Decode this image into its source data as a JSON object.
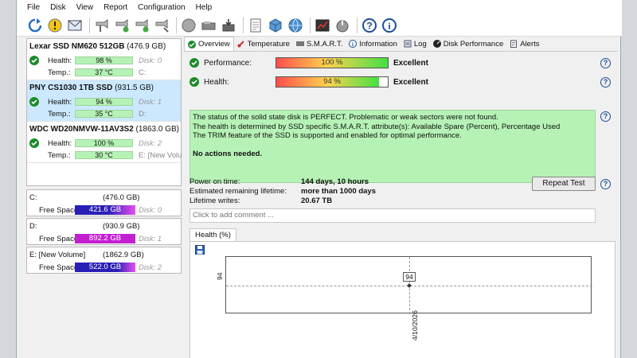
{
  "menu": [
    "File",
    "Disk",
    "View",
    "Report",
    "Configuration",
    "Help"
  ],
  "toolbar_icons": [
    "refresh-icon",
    "warning-icon",
    "envelope-icon",
    "smart-test-icon",
    "smart-test-icon",
    "smart-test-icon",
    "smart-test-icon",
    "disk-icon",
    "disk-icon",
    "disk-icon",
    "document-icon",
    "cube-icon",
    "network-icon",
    "benchmark-icon",
    "power-icon",
    "help-icon",
    "info-icon"
  ],
  "disks": [
    {
      "name": "Lexar SSD NM620 512GB",
      "capacity": "(476.9 GB)",
      "health_label": "Health:",
      "health": "98 %",
      "health_value": 98,
      "temp_label": "Temp.:",
      "temp": "37 °C",
      "disk": "Disk: 0",
      "drive": "C:",
      "selected": false
    },
    {
      "name": "PNY CS1030 1TB SSD",
      "capacity": "(931.5 GB)",
      "health_label": "Health:",
      "health": "94 %",
      "health_value": 94,
      "temp_label": "Temp.:",
      "temp": "35 °C",
      "disk": "Disk: 1",
      "drive": "D:",
      "selected": true
    },
    {
      "name": "WDC WD20NMVW-11AV3S2",
      "capacity": "(1863.0 GB)",
      "health_label": "Health:",
      "health": "100 %",
      "health_value": 100,
      "temp_label": "Temp.:",
      "temp": "30 °C",
      "disk": "Disk: 2",
      "drive": "E: [New Volu",
      "selected": false
    }
  ],
  "volumes": [
    {
      "name": "C:",
      "size": "(476.0 GB)",
      "free_label": "Free Space",
      "free": "421.6 GB",
      "disk": "Disk: 0",
      "bar_color": "#2a1fb5"
    },
    {
      "name": "D:",
      "size": "(930.9 GB)",
      "free_label": "Free Space",
      "free": "892.2 GB",
      "disk": "Disk: 1",
      "bar_color": "#c21fd1"
    },
    {
      "name": "E: [New Volume]",
      "size": "(1862.9 GB)",
      "free_label": "Free Space",
      "free": "522.0 GB",
      "disk": "Disk: 2",
      "bar_color": "#2a1fb5"
    }
  ],
  "tabs": [
    "Overview",
    "Temperature",
    "S.M.A.R.T.",
    "Information",
    "Log",
    "Disk Performance",
    "Alerts"
  ],
  "performance": {
    "label": "Performance:",
    "value": "100 %",
    "verdict": "Excellent"
  },
  "health": {
    "label": "Health:",
    "value": "94 %",
    "verdict": "Excellent"
  },
  "status_lines": [
    "The status of the solid state disk is PERFECT. Problematic or weak sectors were not found.",
    "The health is determined by SSD specific S.M.A.R.T. attribute(s):  Available Spare (Percent), Percentage Used",
    "The TRIM feature of the SSD is supported and enabled for optimal performance."
  ],
  "no_actions": "No actions needed.",
  "stats": [
    {
      "label": "Power on time:",
      "value": "144 days, 10 hours"
    },
    {
      "label": "Estimated remaining lifetime:",
      "value": "more than 1000 days"
    },
    {
      "label": "Lifetime writes:",
      "value": "20.67 TB"
    }
  ],
  "repeat_button": "Repeat Test",
  "comment_placeholder": "Click to add comment ...",
  "chart_tab": "Health (%)",
  "chart_data": {
    "type": "line",
    "x": [
      "4/10/2026"
    ],
    "series": [
      {
        "values": [
          94
        ]
      }
    ],
    "data_labels": [
      "94"
    ],
    "ytick": "94",
    "xtick": "4/10/2026",
    "grid": true
  },
  "colors": {
    "ok_green": "#1c8a2b",
    "status_bg": "#b6f2b6",
    "selection": "#cce8ff"
  }
}
